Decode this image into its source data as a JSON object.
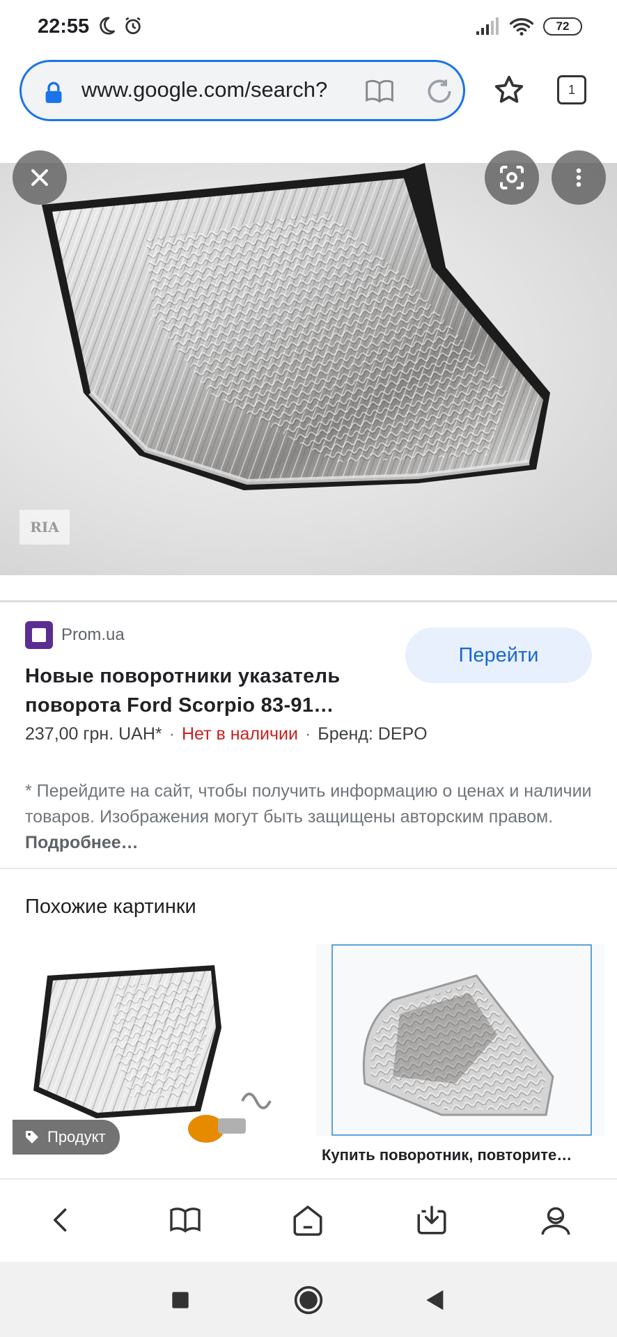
{
  "status_bar": {
    "time": "22:55",
    "battery": "72"
  },
  "browser": {
    "url": "www.google.com/search?",
    "tab_count": "1"
  },
  "result": {
    "source": "Prom.ua",
    "goto_label": "Перейти",
    "title": "Новые поворотники указатель поворота Ford Scorpio 83-91…",
    "price": "237,00 грн. UAH*",
    "separator": "·",
    "availability": "Нет в наличии",
    "brand": "Бренд: DEPO",
    "disclaimer": "* Перейдите на сайт, чтобы получить информацию о ценах и наличии товаров. Изображения могут быть защищены авторским правом.",
    "more_link": "Подробнее…",
    "watermark": "RIA"
  },
  "similar": {
    "heading": "Похожие картинки",
    "badge": "Продукт",
    "caption_2": "Купить поворотник, повторите…"
  },
  "colors": {
    "accent": "#1a73e8",
    "favicon": "#5b2d91",
    "out_of_stock": "#c5221f"
  }
}
